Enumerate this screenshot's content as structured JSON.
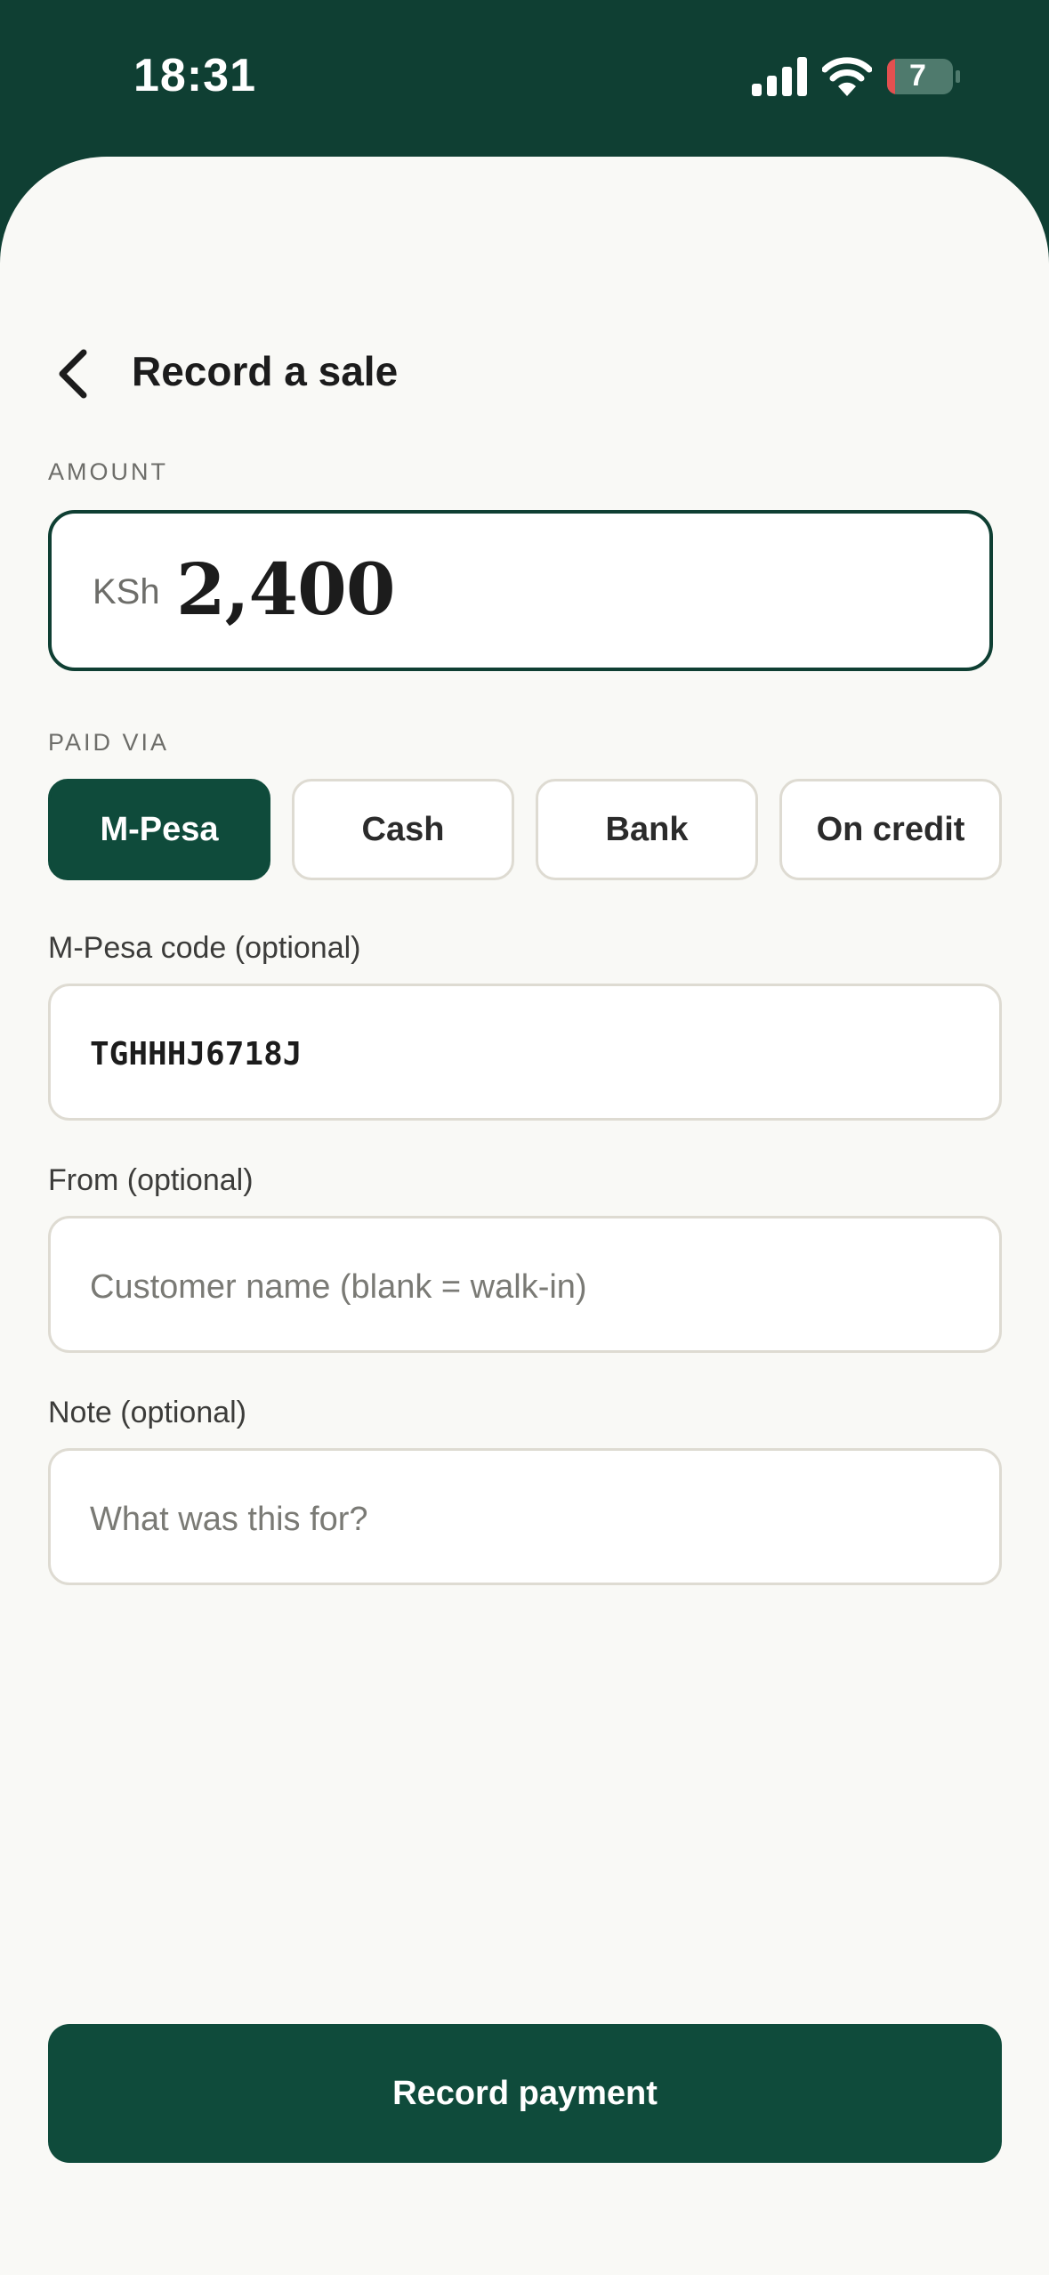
{
  "status": {
    "time": "18:31",
    "battery": "7"
  },
  "header": {
    "title": "Record a sale"
  },
  "amount": {
    "label": "AMOUNT",
    "currency": "KSh",
    "value": "2,400"
  },
  "paid_via": {
    "label": "PAID VIA",
    "options": [
      "M-Pesa",
      "Cash",
      "Bank",
      "On credit"
    ],
    "selected": "M-Pesa"
  },
  "mpesa_code": {
    "label": "M-Pesa code (optional)",
    "value": "TGHHHJ6718J"
  },
  "from": {
    "label": "From (optional)",
    "placeholder": "Customer name (blank = walk-in)"
  },
  "note": {
    "label": "Note (optional)",
    "placeholder": "What was this for?"
  },
  "submit": {
    "label": "Record payment"
  },
  "colors": {
    "brand": "#0f3f33",
    "accent": "#0f4b3b",
    "background": "#f9f9f6",
    "border": "#dedbd2"
  }
}
